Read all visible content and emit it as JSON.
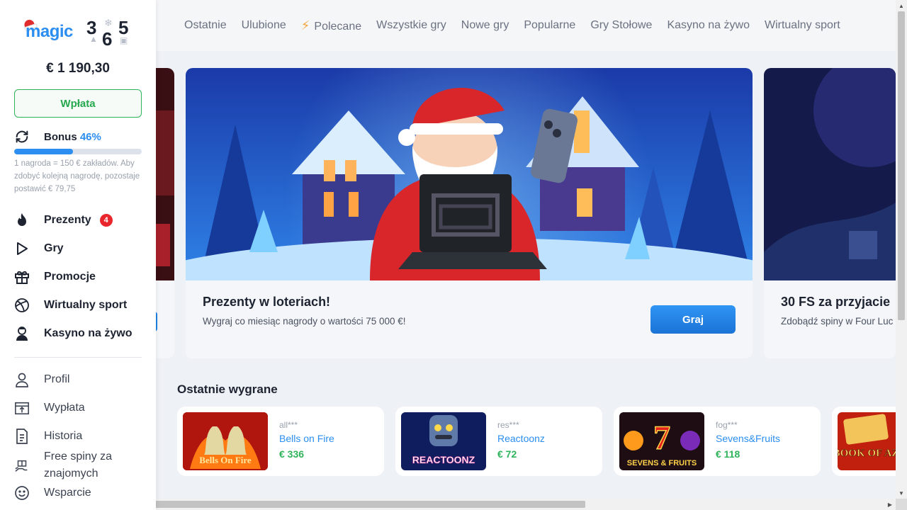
{
  "logo": {
    "text": "magic",
    "digits": [
      "3",
      "6",
      "5"
    ]
  },
  "balance": "€ 1 190,30",
  "deposit_label": "Wpłata",
  "bonus": {
    "label": "Bonus",
    "percent_text": "46%",
    "progress": 0.46,
    "note": "1 nagroda = 150 € zakładów. Aby zdobyć kolejną nagrodę, pozostaje postawić € 79,75"
  },
  "menu": [
    {
      "label": "Prezenty",
      "icon": "flame-icon",
      "badge": "4"
    },
    {
      "label": "Gry",
      "icon": "play-icon"
    },
    {
      "label": "Promocje",
      "icon": "gift-icon"
    },
    {
      "label": "Wirtualny sport",
      "icon": "ball-icon"
    },
    {
      "label": "Kasyno na żywo",
      "icon": "dealer-icon"
    }
  ],
  "menu_secondary": [
    {
      "label": "Profil",
      "icon": "user-icon"
    },
    {
      "label": "Wypłata",
      "icon": "withdraw-icon"
    },
    {
      "label": "Historia",
      "icon": "document-icon"
    },
    {
      "label": "Free spiny za znajomych",
      "icon": "gift-hand-icon"
    },
    {
      "label": "Wsparcie",
      "icon": "smile-icon"
    }
  ],
  "topnav": [
    "Ostatnie",
    "Ulubione",
    "Polecane",
    "Wszystkie gry",
    "Nowe gry",
    "Popularne",
    "Gry Stołowe",
    "Kasyno na żywo",
    "Wirtualny sport"
  ],
  "banner": {
    "title": "Prezenty w loteriach!",
    "subtitle": "Wygraj co miesiąc nagrody o wartości 75 000 €!",
    "button": "Graj"
  },
  "banner_right": {
    "title": "30 FS za przyjacie",
    "subtitle": "Zdobądź spiny w Four Luc"
  },
  "recent_wins": {
    "title": "Ostatnie wygrane",
    "items": [
      {
        "user": "all***",
        "game": "Bells on Fire",
        "amount": "€ 336",
        "thumb_text": "Bells On Fire"
      },
      {
        "user": "res***",
        "game": "Reactoonz",
        "amount": "€ 72",
        "thumb_text": "REACTOONZ"
      },
      {
        "user": "fog***",
        "game": "Sevens&Fruits",
        "amount": "€ 118",
        "thumb_text": "SEVENS & FRUITS"
      },
      {
        "thumb_text": "BOOK OF AZ"
      }
    ]
  },
  "colors": {
    "accent": "#2b8ef0",
    "success": "#2fb35a",
    "badge": "#e8262c"
  }
}
